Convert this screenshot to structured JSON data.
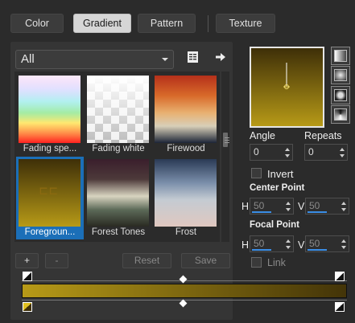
{
  "tabs": [
    {
      "label": "Color"
    },
    {
      "label": "Gradient"
    },
    {
      "label": "Pattern"
    },
    {
      "label": "Texture"
    }
  ],
  "active_tab": "Gradient",
  "category": {
    "selected": "All"
  },
  "gradients": [
    {
      "label": "Fading spe..."
    },
    {
      "label": "Fading white"
    },
    {
      "label": "Firewood"
    },
    {
      "label": "Foregroun..."
    },
    {
      "label": "Forest Tones"
    },
    {
      "label": "Frost"
    }
  ],
  "selected_gradient": "Foregroun...",
  "buttons": {
    "add": "+",
    "remove": "-",
    "reset": "Reset",
    "save": "Save"
  },
  "angle": {
    "label": "Angle",
    "value": "0"
  },
  "repeats": {
    "label": "Repeats",
    "value": "0"
  },
  "invert": {
    "label": "Invert",
    "checked": false
  },
  "center_point": {
    "label": "Center Point",
    "h_label": "H",
    "h_value": "50",
    "v_label": "V",
    "v_value": "50"
  },
  "focal_point": {
    "label": "Focal Point",
    "h_label": "H",
    "h_value": "50",
    "v_label": "V",
    "v_value": "50"
  },
  "link": {
    "label": "Link",
    "checked": false
  },
  "colors": {
    "accent": "#1b6fb8",
    "gradient_start": "#b79a17",
    "gradient_end": "#433408"
  }
}
